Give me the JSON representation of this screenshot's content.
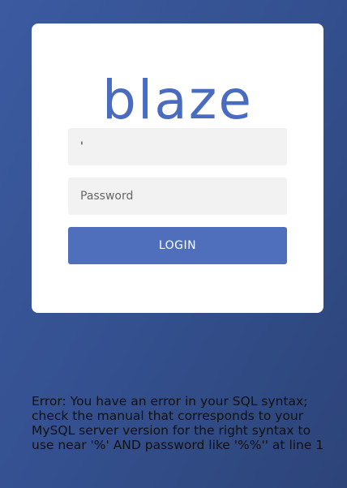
{
  "login": {
    "logo_text": "blaze",
    "username_value": "'",
    "password_placeholder": "Password",
    "login_button_label": "LOGIN"
  },
  "error": {
    "message": "Error: You have an error in your SQL syntax; check the manual that corresponds to your MySQL server version for the right syntax to use near '%' AND password like '%%'' at line 1"
  }
}
